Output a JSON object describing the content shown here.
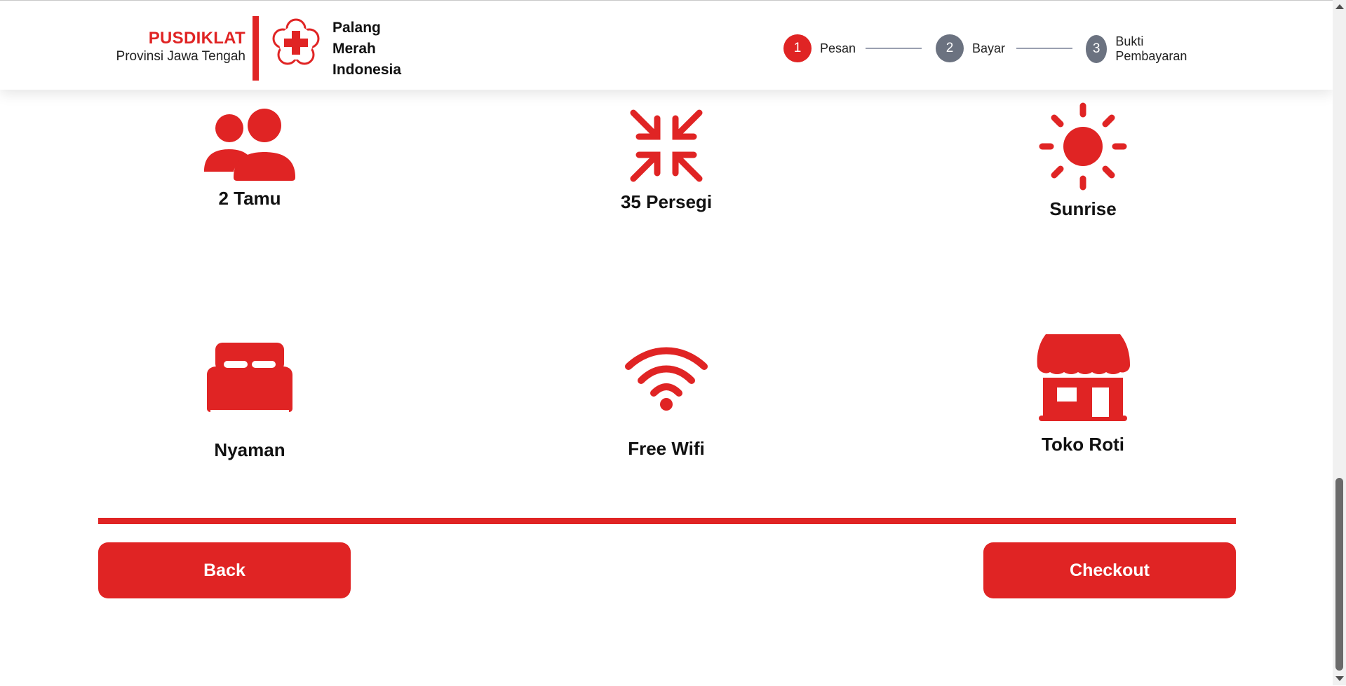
{
  "header": {
    "brand_title": "PUSDIKLAT",
    "brand_subtitle": "Provinsi Jawa Tengah",
    "org_name_line1": "Palang",
    "org_name_line2": "Merah",
    "org_name_line3": "Indonesia",
    "accent_color": "#e02424"
  },
  "stepper": {
    "steps": [
      {
        "number": "1",
        "label": "Pesan",
        "state": "active"
      },
      {
        "number": "2",
        "label": "Bayar",
        "state": "inactive"
      },
      {
        "number": "3",
        "label": "Bukti Pembayaran",
        "state": "inactive"
      }
    ]
  },
  "features": [
    {
      "icon": "users-icon",
      "label": "2 Tamu"
    },
    {
      "icon": "compress-arrows-icon",
      "label": "35 Persegi"
    },
    {
      "icon": "sun-icon",
      "label": "Sunrise"
    },
    {
      "icon": "bed-icon",
      "label": "Nyaman"
    },
    {
      "icon": "wifi-icon",
      "label": "Free Wifi"
    },
    {
      "icon": "store-icon",
      "label": "Toko Roti"
    }
  ],
  "actions": {
    "back_label": "Back",
    "checkout_label": "Checkout"
  }
}
